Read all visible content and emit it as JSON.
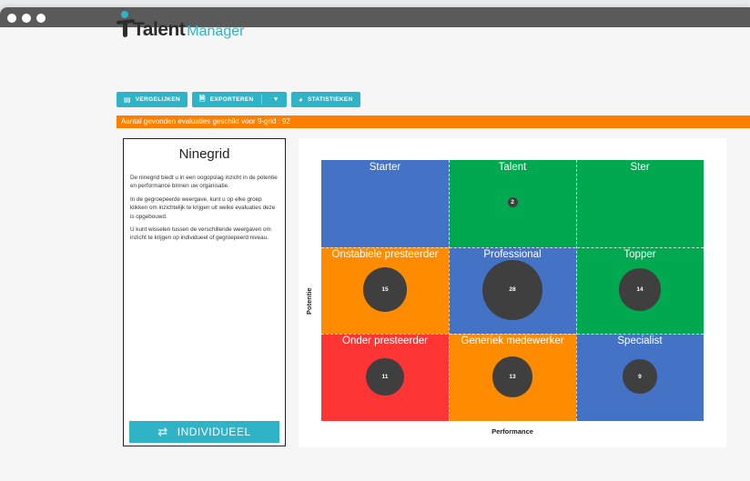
{
  "app": {
    "logo_bold": "Talent",
    "logo_light": "Manager"
  },
  "toolbar": {
    "compare_label": "VERGELIJKEN",
    "export_label": "EXPORTEREN",
    "stats_label": "STATISTIEKEN"
  },
  "banner": {
    "text": "Aantal gevonden evaluaties geschikt voor 9-grid : 92"
  },
  "sidebar": {
    "title": "Ninegrid",
    "paragraphs": [
      "De ninegrid biedt u in een oogopslag inzicht in de potentie en performance binnen uw organisatie.",
      "In de gegroepeerde weergave, kunt u op elke groep klikken om inzichtelijk te krijgen uit welke evaluaties deze is opgebouwd.",
      "U kunt wisselen tussen de verschillende weergaven om inzicht te krijgen op individueel of gegroepeerd niveau."
    ],
    "button_label": "INDIVIDUEEL"
  },
  "chart_data": {
    "type": "heatmap",
    "xlabel": "Performance",
    "ylabel": "Potentie",
    "cells": [
      {
        "row": 0,
        "col": 0,
        "label": "Starter",
        "color": "#4472c4",
        "count": null
      },
      {
        "row": 0,
        "col": 1,
        "label": "Talent",
        "color": "#00a84f",
        "count": 2
      },
      {
        "row": 0,
        "col": 2,
        "label": "Ster",
        "color": "#00a84f",
        "count": null
      },
      {
        "row": 1,
        "col": 0,
        "label": "Onstabiele presteerder",
        "color": "#ff8c00",
        "count": 15
      },
      {
        "row": 1,
        "col": 1,
        "label": "Professional",
        "color": "#4472c4",
        "count": 28
      },
      {
        "row": 1,
        "col": 2,
        "label": "Topper",
        "color": "#00a84f",
        "count": 14
      },
      {
        "row": 2,
        "col": 0,
        "label": "Onder presteerder",
        "color": "#ff3535",
        "count": 11
      },
      {
        "row": 2,
        "col": 1,
        "label": "Generiek medewerker",
        "color": "#ff8c00",
        "count": 13
      },
      {
        "row": 2,
        "col": 2,
        "label": "Specialist",
        "color": "#4472c4",
        "count": 9
      }
    ]
  }
}
